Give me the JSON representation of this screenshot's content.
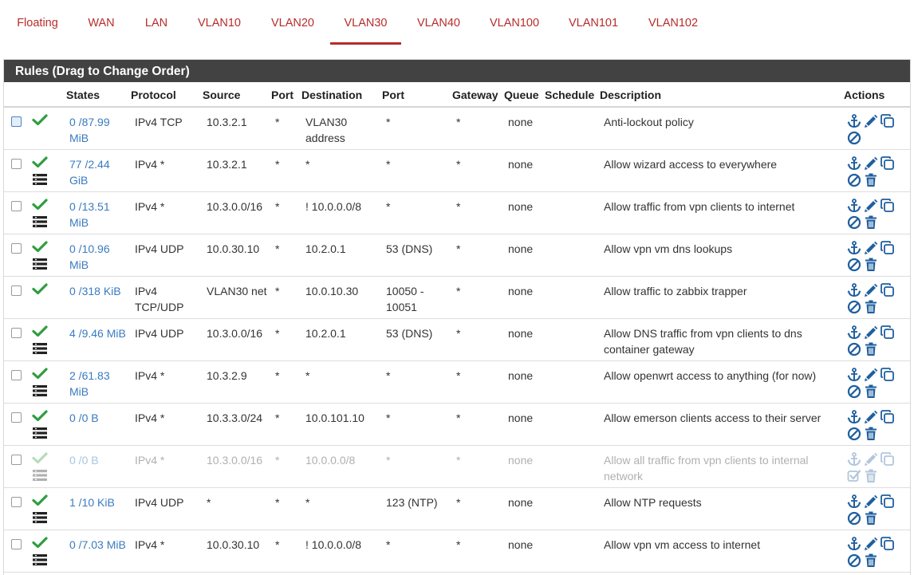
{
  "tabs": [
    {
      "label": "Floating",
      "active": false
    },
    {
      "label": "WAN",
      "active": false
    },
    {
      "label": "LAN",
      "active": false
    },
    {
      "label": "VLAN10",
      "active": false
    },
    {
      "label": "VLAN20",
      "active": false
    },
    {
      "label": "VLAN30",
      "active": true
    },
    {
      "label": "VLAN40",
      "active": false
    },
    {
      "label": "VLAN100",
      "active": false
    },
    {
      "label": "VLAN101",
      "active": false
    },
    {
      "label": "VLAN102",
      "active": false
    }
  ],
  "panel": {
    "title": "Rules (Drag to Change Order)"
  },
  "columns": {
    "states": "States",
    "protocol": "Protocol",
    "source": "Source",
    "port": "Port",
    "destination": "Destination",
    "dport": "Port",
    "gateway": "Gateway",
    "queue": "Queue",
    "schedule": "Schedule",
    "description": "Description",
    "actions": "Actions"
  },
  "colors": {
    "accent": "#b72c2c",
    "header_bg": "#424242",
    "link": "#3a7bbf",
    "pass": "#2e9e3e",
    "icon": "#1f5f9e"
  },
  "rules": [
    {
      "states": "0 /87.99 MiB",
      "protocol": "IPv4 TCP",
      "source": "10.3.2.1",
      "port": "*",
      "destination": "VLAN30 address",
      "dport": "*",
      "gateway": "*",
      "queue": "none",
      "schedule": "",
      "description": "Anti-lockout policy",
      "log": false,
      "disabled": false,
      "anti_lockout": true,
      "checkbox_style": "blue",
      "toggle_icon": "block-icon"
    },
    {
      "states": "77 /2.44 GiB",
      "protocol": "IPv4 *",
      "source": "10.3.2.1",
      "port": "*",
      "destination": "*",
      "dport": "*",
      "gateway": "*",
      "queue": "none",
      "schedule": "",
      "description": "Allow wizard access to everywhere",
      "log": true,
      "disabled": false,
      "toggle_icon": "block-icon"
    },
    {
      "states": "0 /13.51 MiB",
      "protocol": "IPv4 *",
      "source": "10.3.0.0/16",
      "port": "*",
      "destination": "! 10.0.0.0/8",
      "dport": "*",
      "gateway": "*",
      "queue": "none",
      "schedule": "",
      "description": "Allow traffic from vpn clients to internet",
      "log": true,
      "disabled": false,
      "toggle_icon": "block-icon"
    },
    {
      "states": "0 /10.96 MiB",
      "protocol": "IPv4 UDP",
      "source": "10.0.30.10",
      "port": "*",
      "destination": "10.2.0.1",
      "dport": "53 (DNS)",
      "gateway": "*",
      "queue": "none",
      "schedule": "",
      "description": "Allow vpn vm dns lookups",
      "log": true,
      "disabled": false,
      "toggle_icon": "block-icon"
    },
    {
      "states": "0 /318 KiB",
      "protocol": "IPv4 TCP/UDP",
      "source": "VLAN30 net",
      "port": "*",
      "destination": "10.0.10.30",
      "dport": "10050 - 10051",
      "gateway": "*",
      "queue": "none",
      "schedule": "",
      "description": "Allow traffic to zabbix trapper",
      "log": false,
      "disabled": false,
      "toggle_icon": "block-icon"
    },
    {
      "states": "4 /9.46 MiB",
      "protocol": "IPv4 UDP",
      "source": "10.3.0.0/16",
      "port": "*",
      "destination": "10.2.0.1",
      "dport": "53 (DNS)",
      "gateway": "*",
      "queue": "none",
      "schedule": "",
      "description": "Allow DNS traffic from vpn clients to dns container gateway",
      "log": true,
      "disabled": false,
      "toggle_icon": "block-icon"
    },
    {
      "states": "2 /61.83 MiB",
      "protocol": "IPv4 *",
      "source": "10.3.2.9",
      "port": "*",
      "destination": "*",
      "dport": "*",
      "gateway": "*",
      "queue": "none",
      "schedule": "",
      "description": "Allow openwrt access to anything (for now)",
      "log": true,
      "disabled": false,
      "toggle_icon": "block-icon"
    },
    {
      "states": "0 /0 B",
      "protocol": "IPv4 *",
      "source": "10.3.3.0/24",
      "port": "*",
      "destination": "10.0.101.10",
      "dport": "*",
      "gateway": "*",
      "queue": "none",
      "schedule": "",
      "description": "Allow emerson clients access to their server",
      "log": true,
      "disabled": false,
      "toggle_icon": "block-icon"
    },
    {
      "states": "0 /0 B",
      "protocol": "IPv4 *",
      "source": "10.3.0.0/16",
      "port": "*",
      "destination": "10.0.0.0/8",
      "dport": "*",
      "gateway": "*",
      "queue": "none",
      "schedule": "",
      "description": "Allow all traffic from vpn clients to internal network",
      "log": true,
      "disabled": true,
      "toggle_icon": "enable-icon"
    },
    {
      "states": "1 /10 KiB",
      "protocol": "IPv4 UDP",
      "source": "*",
      "port": "*",
      "destination": "*",
      "dport": "123 (NTP)",
      "gateway": "*",
      "queue": "none",
      "schedule": "",
      "description": "Allow NTP requests",
      "log": true,
      "disabled": false,
      "toggle_icon": "block-icon"
    },
    {
      "states": "0 /7.03 MiB",
      "protocol": "IPv4 *",
      "source": "10.0.30.10",
      "port": "*",
      "destination": "! 10.0.0.0/8",
      "dport": "*",
      "gateway": "*",
      "queue": "none",
      "schedule": "",
      "description": "Allow vpn vm access to internet",
      "log": true,
      "disabled": false,
      "toggle_icon": "block-icon"
    }
  ]
}
